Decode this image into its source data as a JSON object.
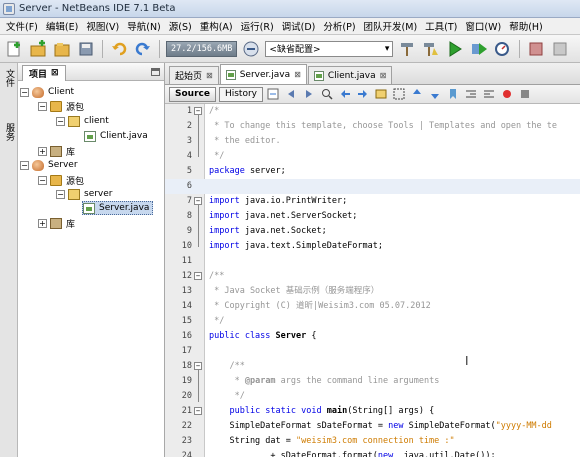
{
  "window": {
    "title": "Server - NetBeans IDE 7.1 Beta"
  },
  "menu": [
    "文件(F)",
    "编辑(E)",
    "视图(V)",
    "导航(N)",
    "源(S)",
    "重构(A)",
    "运行(R)",
    "调试(D)",
    "分析(P)",
    "团队开发(M)",
    "工具(T)",
    "窗口(W)",
    "帮助(H)"
  ],
  "toolbar": {
    "memory": "27.2/156.6MB",
    "config": "<缺省配置>"
  },
  "strip": {
    "files": "文件",
    "services": "服务"
  },
  "projects": {
    "tab_label": "项目",
    "tree": [
      {
        "label": "Client"
      },
      {
        "label": "源包"
      },
      {
        "label": "client"
      },
      {
        "label": "Client.java"
      },
      {
        "label": "库"
      },
      {
        "label": "Server"
      },
      {
        "label": "源包"
      },
      {
        "label": "server"
      },
      {
        "label": "Server.java"
      },
      {
        "label": "库"
      }
    ]
  },
  "editor": {
    "tabs": [
      "起始页",
      "Server.java",
      "Client.java"
    ],
    "modes": [
      "Source",
      "History"
    ],
    "lines": [
      {
        "n": "1",
        "html": "<span class='cm'>/*</span>"
      },
      {
        "n": "2",
        "html": "<span class='cm'> * To change this template, choose Tools | Templates and open the te</span>"
      },
      {
        "n": "3",
        "html": "<span class='cm'> * the editor.</span>"
      },
      {
        "n": "4",
        "html": "<span class='cm'> */</span>"
      },
      {
        "n": "5",
        "html": "<span class='kw'>package</span> server;"
      },
      {
        "n": "6",
        "html": ""
      },
      {
        "n": "7",
        "html": "<span class='kw'>import</span> java.io.PrintWriter;"
      },
      {
        "n": "8",
        "html": "<span class='kw'>import</span> java.net.ServerSocket;"
      },
      {
        "n": "9",
        "html": "<span class='kw'>import</span> java.net.Socket;"
      },
      {
        "n": "10",
        "html": "<span class='kw'>import</span> java.text.SimpleDateFormat;"
      },
      {
        "n": "11",
        "html": ""
      },
      {
        "n": "12",
        "html": "<span class='cm'>/**</span>"
      },
      {
        "n": "13",
        "html": "<span class='cm'> * Java Socket 基础示例（服务端程序）</span>"
      },
      {
        "n": "14",
        "html": "<span class='cm'> * Copyright (C) 道昕|Weisim3.com 05.07.2012</span>"
      },
      {
        "n": "15",
        "html": "<span class='cm'> */</span>"
      },
      {
        "n": "16",
        "html": "<span class='kw'>public class</span> <span class='bold'>Server</span> {"
      },
      {
        "n": "17",
        "html": ""
      },
      {
        "n": "18",
        "html": "    <span class='cm'>/**</span>"
      },
      {
        "n": "19",
        "html": "    <span class='cm'> * <b>@param</b> args the command line arguments</span>"
      },
      {
        "n": "20",
        "html": "    <span class='cm'> */</span>"
      },
      {
        "n": "21",
        "html": "    <span class='kw'>public static void</span> <span class='bold'>main</span>(String[] args) {"
      },
      {
        "n": "22",
        "html": "    SimpleDateFormat sDateFormat = <span class='kw'>new</span> SimpleDateFormat(<span class='str'>\"yyyy-MM-dd</span>"
      },
      {
        "n": "23",
        "html": "    String dat = <span class='str'>\"weisim3.com connection time :\"</span>"
      },
      {
        "n": "24",
        "html": "            + sDateFormat.format(<span class='kw'>new</span>  java.util.Date());"
      }
    ]
  }
}
